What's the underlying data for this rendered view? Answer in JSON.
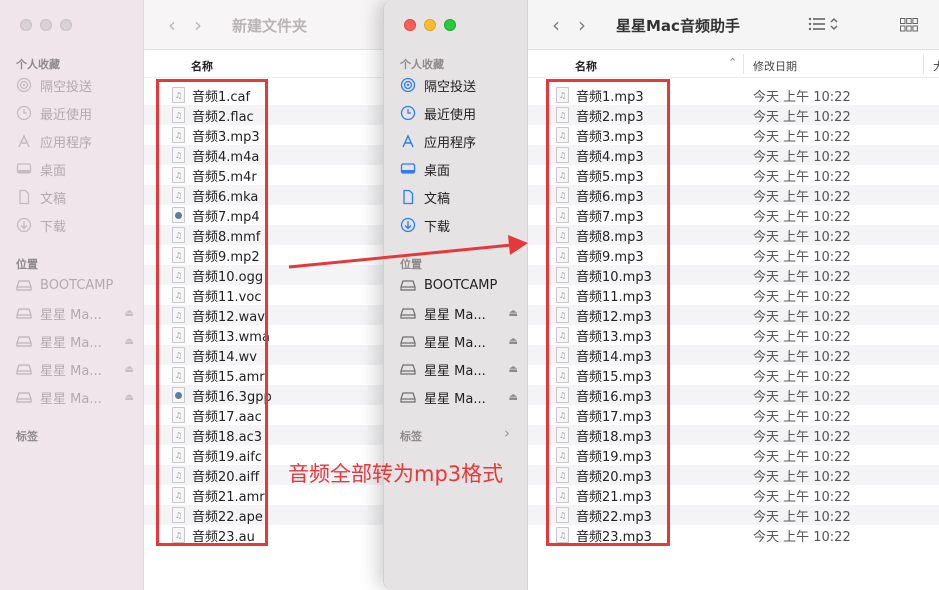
{
  "back_window": {
    "title": "新建文件夹",
    "nav_back": "‹",
    "nav_forward": "›",
    "column_name": "名称",
    "sidebar": {
      "favorites_label": "个人收藏",
      "favorites": [
        {
          "label": "隔空投送",
          "icon": "airdrop-icon"
        },
        {
          "label": "最近使用",
          "icon": "clock-icon"
        },
        {
          "label": "应用程序",
          "icon": "apps-icon"
        },
        {
          "label": "桌面",
          "icon": "desktop-icon"
        },
        {
          "label": "文稿",
          "icon": "document-icon"
        },
        {
          "label": "下载",
          "icon": "download-icon"
        }
      ],
      "locations_label": "位置",
      "locations": [
        {
          "label": "BOOTCAMP",
          "eject": false
        },
        {
          "label": "星星 Ma...",
          "eject": true
        },
        {
          "label": "星星 Ma...",
          "eject": true
        },
        {
          "label": "星星 Ma...",
          "eject": true
        },
        {
          "label": "星星 Ma...",
          "eject": true
        }
      ],
      "tags_label": "标签"
    },
    "files": [
      "音频1.caf",
      "音频2.flac",
      "音频3.mp3",
      "音频4.m4a",
      "音频5.m4r",
      "音频6.mka",
      "音频7.mp4",
      "音频8.mmf",
      "音频9.mp2",
      "音频10.ogg",
      "音频11.voc",
      "音频12.wav",
      "音频13.wma",
      "音频14.wv",
      "音频15.amr",
      "音频16.3gpp",
      "音频17.aac",
      "音频18.ac3",
      "音频19.aifc",
      "音频20.aiff",
      "音频21.amr",
      "音频22.ape",
      "音频23.au"
    ]
  },
  "front_window": {
    "title": "星星Mac音频助手",
    "nav_back": "‹",
    "nav_forward": "›",
    "view_icon": "list-view-icon",
    "grid_icon": "grid-view-icon",
    "column_name": "名称",
    "column_date": "修改日期",
    "column_size": "大",
    "sidebar": {
      "favorites_label": "个人收藏",
      "favorites": [
        {
          "label": "隔空投送",
          "icon": "airdrop-icon"
        },
        {
          "label": "最近使用",
          "icon": "clock-icon"
        },
        {
          "label": "应用程序",
          "icon": "apps-icon"
        },
        {
          "label": "桌面",
          "icon": "desktop-icon"
        },
        {
          "label": "文稿",
          "icon": "document-icon"
        },
        {
          "label": "下载",
          "icon": "download-icon"
        }
      ],
      "locations_label": "位置",
      "locations": [
        {
          "label": "BOOTCAMP",
          "eject": false
        },
        {
          "label": "星星 Ma...",
          "eject": true
        },
        {
          "label": "星星 Ma...",
          "eject": true
        },
        {
          "label": "星星 Ma...",
          "eject": true
        },
        {
          "label": "星星 Ma...",
          "eject": true
        }
      ],
      "tags_label": "标签",
      "tags_chevron": "›"
    },
    "files": [
      {
        "name": "音频1.mp3",
        "date": "今天 上午 10:22"
      },
      {
        "name": "音频2.mp3",
        "date": "今天 上午 10:22"
      },
      {
        "name": "音频3.mp3",
        "date": "今天 上午 10:22"
      },
      {
        "name": "音频4.mp3",
        "date": "今天 上午 10:22"
      },
      {
        "name": "音频5.mp3",
        "date": "今天 上午 10:22"
      },
      {
        "name": "音频6.mp3",
        "date": "今天 上午 10:22"
      },
      {
        "name": "音频7.mp3",
        "date": "今天 上午 10:22"
      },
      {
        "name": "音频8.mp3",
        "date": "今天 上午 10:22"
      },
      {
        "name": "音频9.mp3",
        "date": "今天 上午 10:22"
      },
      {
        "name": "音频10.mp3",
        "date": "今天 上午 10:22"
      },
      {
        "name": "音频11.mp3",
        "date": "今天 上午 10:22"
      },
      {
        "name": "音频12.mp3",
        "date": "今天 上午 10:22"
      },
      {
        "name": "音频13.mp3",
        "date": "今天 上午 10:22"
      },
      {
        "name": "音频14.mp3",
        "date": "今天 上午 10:22"
      },
      {
        "name": "音频15.mp3",
        "date": "今天 上午 10:22"
      },
      {
        "name": "音频16.mp3",
        "date": "今天 上午 10:22"
      },
      {
        "name": "音频17.mp3",
        "date": "今天 上午 10:22"
      },
      {
        "name": "音频18.mp3",
        "date": "今天 上午 10:22"
      },
      {
        "name": "音频19.mp3",
        "date": "今天 上午 10:22"
      },
      {
        "name": "音频20.mp3",
        "date": "今天 上午 10:22"
      },
      {
        "name": "音频21.mp3",
        "date": "今天 上午 10:22"
      },
      {
        "name": "音频22.mp3",
        "date": "今天 上午 10:22"
      },
      {
        "name": "音频23.mp3",
        "date": "今天 上午 10:22"
      }
    ]
  },
  "annotation": {
    "text": "音频全部转为mp3格式",
    "color": "#e5383b"
  }
}
